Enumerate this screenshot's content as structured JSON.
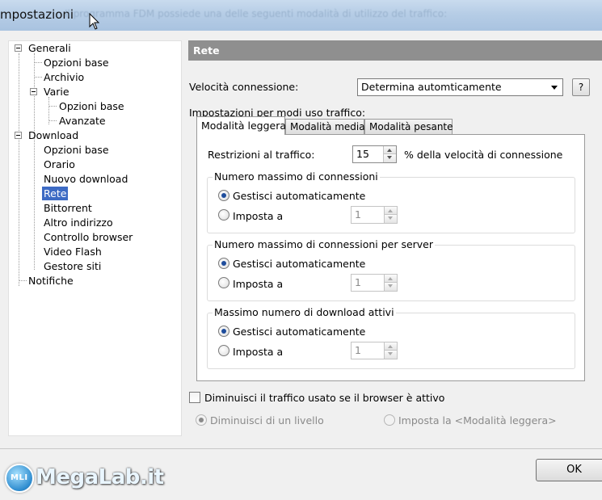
{
  "window": {
    "title": "mpostazioni",
    "ghost_text": "Il programma FDM possiede una delle seguenti modalità di utilizzo del traffico:"
  },
  "tree": {
    "items": [
      {
        "label": "Generali",
        "level": 0
      },
      {
        "label": "Opzioni base",
        "level": 1
      },
      {
        "label": "Archivio",
        "level": 1
      },
      {
        "label": "Varie",
        "level": 1
      },
      {
        "label": "Opzioni base",
        "level": 2
      },
      {
        "label": "Avanzate",
        "level": 2
      },
      {
        "label": "Download",
        "level": 0
      },
      {
        "label": "Opzioni base",
        "level": 1
      },
      {
        "label": "Orario",
        "level": 1
      },
      {
        "label": "Nuovo download",
        "level": 1
      },
      {
        "label": "Rete",
        "level": 1,
        "selected": true
      },
      {
        "label": "Bittorrent",
        "level": 1
      },
      {
        "label": "Altro indirizzo",
        "level": 1
      },
      {
        "label": "Controllo browser",
        "level": 1
      },
      {
        "label": "Video Flash",
        "level": 1
      },
      {
        "label": "Gestore siti",
        "level": 1
      },
      {
        "label": "Notifiche",
        "level": 0
      }
    ]
  },
  "panel": {
    "header": "Rete",
    "connection_speed_label": "Velocità connessione:",
    "connection_speed_value": "Determina automticamente",
    "help_label": "?",
    "traffic_modes_label": "Impostazioni per modi uso traffico:",
    "tabs": [
      {
        "label": "Modalità leggera",
        "active": true
      },
      {
        "label": "Modalità media",
        "active": false
      },
      {
        "label": "Modalità pesante",
        "active": false
      }
    ],
    "traffic_limit_label": "Restrizioni al traffico:",
    "traffic_limit_value": "15",
    "traffic_limit_suffix": "% della velocità di connessione",
    "groups": [
      {
        "title": "Numero massimo di connessioni",
        "auto_label": "Gestisci automaticamente",
        "set_label": "Imposta a",
        "value": "1"
      },
      {
        "title": "Numero massimo di connessioni per server",
        "auto_label": "Gestisci automaticamente",
        "set_label": "Imposta a",
        "value": "1"
      },
      {
        "title": "Massimo numero di download attivi",
        "auto_label": "Gestisci automaticamente",
        "set_label": "Imposta a",
        "value": "1"
      }
    ],
    "reduce_traffic_label": "Diminuisci il traffico usato se il browser è attivo",
    "reduce_one_level_label": "Diminuisci di un livello",
    "set_light_mode_label": "Imposta la <Modalità leggera>"
  },
  "footer": {
    "ok_label": "OK"
  },
  "watermark": {
    "badge": "MLI",
    "text": "MegaLab.it"
  },
  "colors": {
    "selection": "#3d6bc4",
    "header_bg": "#8f8f8f",
    "radio_dot": "#1f4d9c"
  }
}
